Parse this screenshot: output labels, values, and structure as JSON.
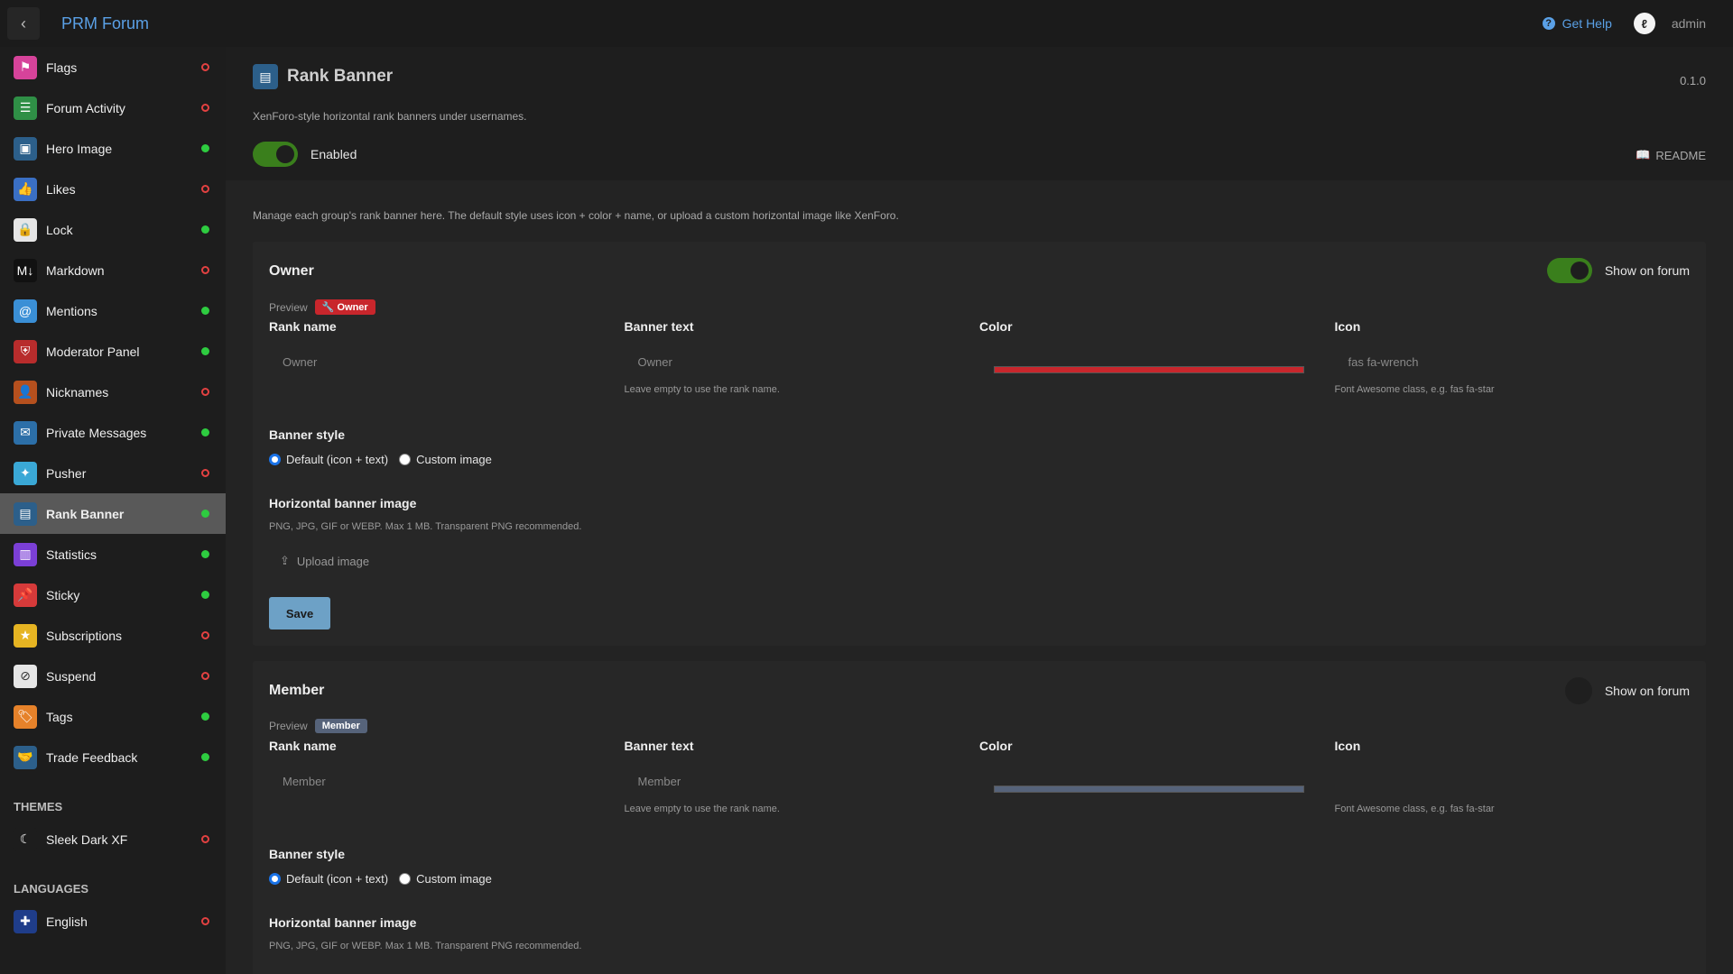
{
  "app": {
    "title": "PRM Forum",
    "back_icon": "chevron-left-icon"
  },
  "topbar": {
    "help_label": "Get Help",
    "help_icon": "question-circle-icon",
    "user_name": "admin",
    "avatar_icon": "avatar-icon"
  },
  "sidebar": {
    "items": [
      {
        "label": "Flags",
        "icon": "flag-icon",
        "glyph": "⚑",
        "color": "#d6439a",
        "enabled": false
      },
      {
        "label": "Forum Activity",
        "icon": "list-icon",
        "glyph": "☰",
        "color": "#2f8f46",
        "enabled": false
      },
      {
        "label": "Hero Image",
        "icon": "image-icon",
        "glyph": "▣",
        "color": "#2c5f8a",
        "enabled": true
      },
      {
        "label": "Likes",
        "icon": "thumbs-up-icon",
        "glyph": "👍",
        "color": "#3a6fc4",
        "enabled": false
      },
      {
        "label": "Lock",
        "icon": "lock-icon",
        "glyph": "🔒",
        "color": "#e6e6e6",
        "enabled": true
      },
      {
        "label": "Markdown",
        "icon": "markdown-icon",
        "glyph": "M↓",
        "color": "#111111",
        "enabled": false
      },
      {
        "label": "Mentions",
        "icon": "at-icon",
        "glyph": "@",
        "color": "#3a8fd6",
        "enabled": true
      },
      {
        "label": "Moderator Panel",
        "icon": "shield-icon",
        "glyph": "⛨",
        "color": "#b82c2c",
        "enabled": true
      },
      {
        "label": "Nicknames",
        "icon": "user-icon",
        "glyph": "👤",
        "color": "#b5501e",
        "enabled": false
      },
      {
        "label": "Private Messages",
        "icon": "envelope-icon",
        "glyph": "✉",
        "color": "#2c6fa8",
        "enabled": true
      },
      {
        "label": "Pusher",
        "icon": "pusher-icon",
        "glyph": "✦",
        "color": "#3aa8d6",
        "enabled": false
      },
      {
        "label": "Rank Banner",
        "icon": "id-badge-icon",
        "glyph": "▤",
        "color": "#2c5f8a",
        "enabled": true
      },
      {
        "label": "Statistics",
        "icon": "chart-icon",
        "glyph": "▥",
        "color": "#7b3fd6",
        "enabled": true
      },
      {
        "label": "Sticky",
        "icon": "pin-icon",
        "glyph": "📌",
        "color": "#d63a3a",
        "enabled": true
      },
      {
        "label": "Subscriptions",
        "icon": "star-icon",
        "glyph": "★",
        "color": "#e6b422",
        "enabled": false
      },
      {
        "label": "Suspend",
        "icon": "ban-icon",
        "glyph": "⊘",
        "color": "#e6e6e6",
        "enabled": false
      },
      {
        "label": "Tags",
        "icon": "tags-icon",
        "glyph": "🏷",
        "color": "#e6822a",
        "enabled": true
      },
      {
        "label": "Trade Feedback",
        "icon": "handshake-icon",
        "glyph": "🤝",
        "color": "#2c5f8a",
        "enabled": true
      }
    ],
    "active_index": 11,
    "themes_heading": "THEMES",
    "themes": [
      {
        "label": "Sleek Dark XF",
        "icon": "moon-icon",
        "glyph": "☾",
        "color": "#1d1d1d",
        "enabled": false
      }
    ],
    "languages_heading": "LANGUAGES",
    "languages": [
      {
        "label": "English",
        "icon": "uk-flag-icon",
        "glyph": "✚",
        "color": "#1f3d8a",
        "enabled": false
      }
    ]
  },
  "plugin": {
    "title": "Rank Banner",
    "icon": "id-badge-icon",
    "version": "0.1.0",
    "description": "XenForo-style horizontal rank banners under usernames.",
    "enabled_label": "Enabled",
    "enabled": true,
    "readme_label": "README",
    "readme_icon": "book-icon"
  },
  "manage_text": "Manage each group's rank banner here. The default style uses icon + color + name, or upload a custom horizontal image like XenForo.",
  "cards": [
    {
      "title": "Owner",
      "show_on_forum": true,
      "show_label": "Show on forum",
      "preview_label": "Preview",
      "badge_text": "Owner",
      "badge_icon": "wrench-icon",
      "labels": {
        "rank_name": "Rank name",
        "banner_text": "Banner text",
        "color": "Color",
        "icon": "Icon"
      },
      "rank_name_placeholder": "Owner",
      "banner_text_placeholder": "Owner",
      "banner_text_help": "Leave empty to use the rank name.",
      "color": "#c8262c",
      "icon_value": "fas fa-wrench",
      "icon_help": "Font Awesome class, e.g. fas fa-star",
      "banner_style_label": "Banner style",
      "style_options": [
        "Default (icon + text)",
        "Custom image"
      ],
      "style_selected": 0,
      "banner_image_label": "Horizontal banner image",
      "banner_image_help": "PNG, JPG, GIF or WEBP. Max 1 MB. Transparent PNG recommended.",
      "upload_label": "Upload image",
      "upload_icon": "upload-icon",
      "save_label": "Save"
    },
    {
      "title": "Member",
      "show_on_forum": false,
      "show_label": "Show on forum",
      "preview_label": "Preview",
      "badge_text": "Member",
      "labels": {
        "rank_name": "Rank name",
        "banner_text": "Banner text",
        "color": "Color",
        "icon": "Icon"
      },
      "rank_name_placeholder": "Member",
      "banner_text_placeholder": "Member",
      "banner_text_help": "Leave empty to use the rank name.",
      "color": "#56637a",
      "icon_value": "",
      "icon_help": "Font Awesome class, e.g. fas fa-star",
      "banner_style_label": "Banner style",
      "style_options": [
        "Default (icon + text)",
        "Custom image"
      ],
      "style_selected": 0,
      "banner_image_label": "Horizontal banner image",
      "banner_image_help": "PNG, JPG, GIF or WEBP. Max 1 MB. Transparent PNG recommended."
    }
  ]
}
